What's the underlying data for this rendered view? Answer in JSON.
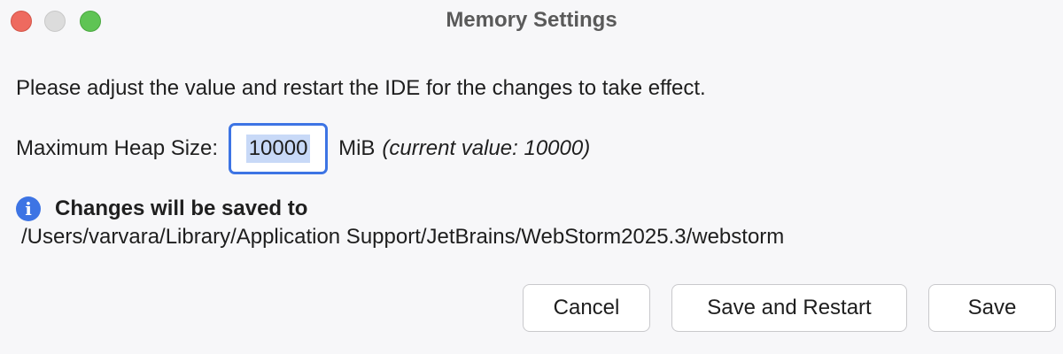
{
  "window": {
    "title": "Memory Settings"
  },
  "instruction": "Please adjust the value and restart the IDE for the changes to take effect.",
  "heap": {
    "label": "Maximum Heap Size:",
    "value": "10000",
    "unit": "MiB",
    "current_note": "(current value: 10000)"
  },
  "info": {
    "icon": "info-icon",
    "title": "Changes will be saved to",
    "path": "/Users/varvara/Library/Application Support/JetBrains/WebStorm2025.3/webstorm"
  },
  "buttons": {
    "cancel": "Cancel",
    "save_restart": "Save and Restart",
    "save": "Save"
  },
  "colors": {
    "accent": "#3d74e4",
    "close": "#ee6a5f",
    "minimize": "#dcdcdc",
    "zoom": "#5fc454"
  }
}
